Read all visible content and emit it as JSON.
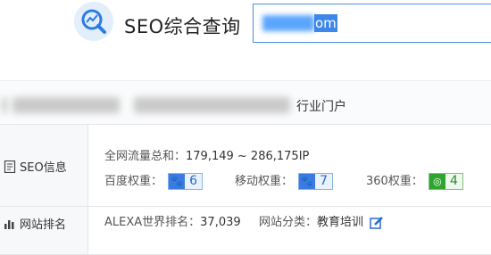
{
  "header": {
    "brand": "SEO综合查询",
    "search_suffix": "om",
    "logo_icon": "chart-magnifier-icon"
  },
  "site": {
    "title_suffix": "行业门户"
  },
  "seo": {
    "label": "SEO信息",
    "total_traffic_label": "全网流量总和：",
    "total_traffic_value": "179,149 ~ 286,175IP",
    "baidu_label": "百度权重：",
    "baidu_value": "6",
    "mobile_label": "移动权重：",
    "mobile_value": "7",
    "so360_label": "360权重：",
    "so360_value": "4"
  },
  "ranking": {
    "label": "网站排名",
    "alexa_label": "ALEXA世界排名：",
    "alexa_value": "37,039",
    "category_label": "网站分类：",
    "category_value": "教育培训"
  },
  "colors": {
    "accent": "#4a90e2",
    "green": "#2ea52e"
  }
}
